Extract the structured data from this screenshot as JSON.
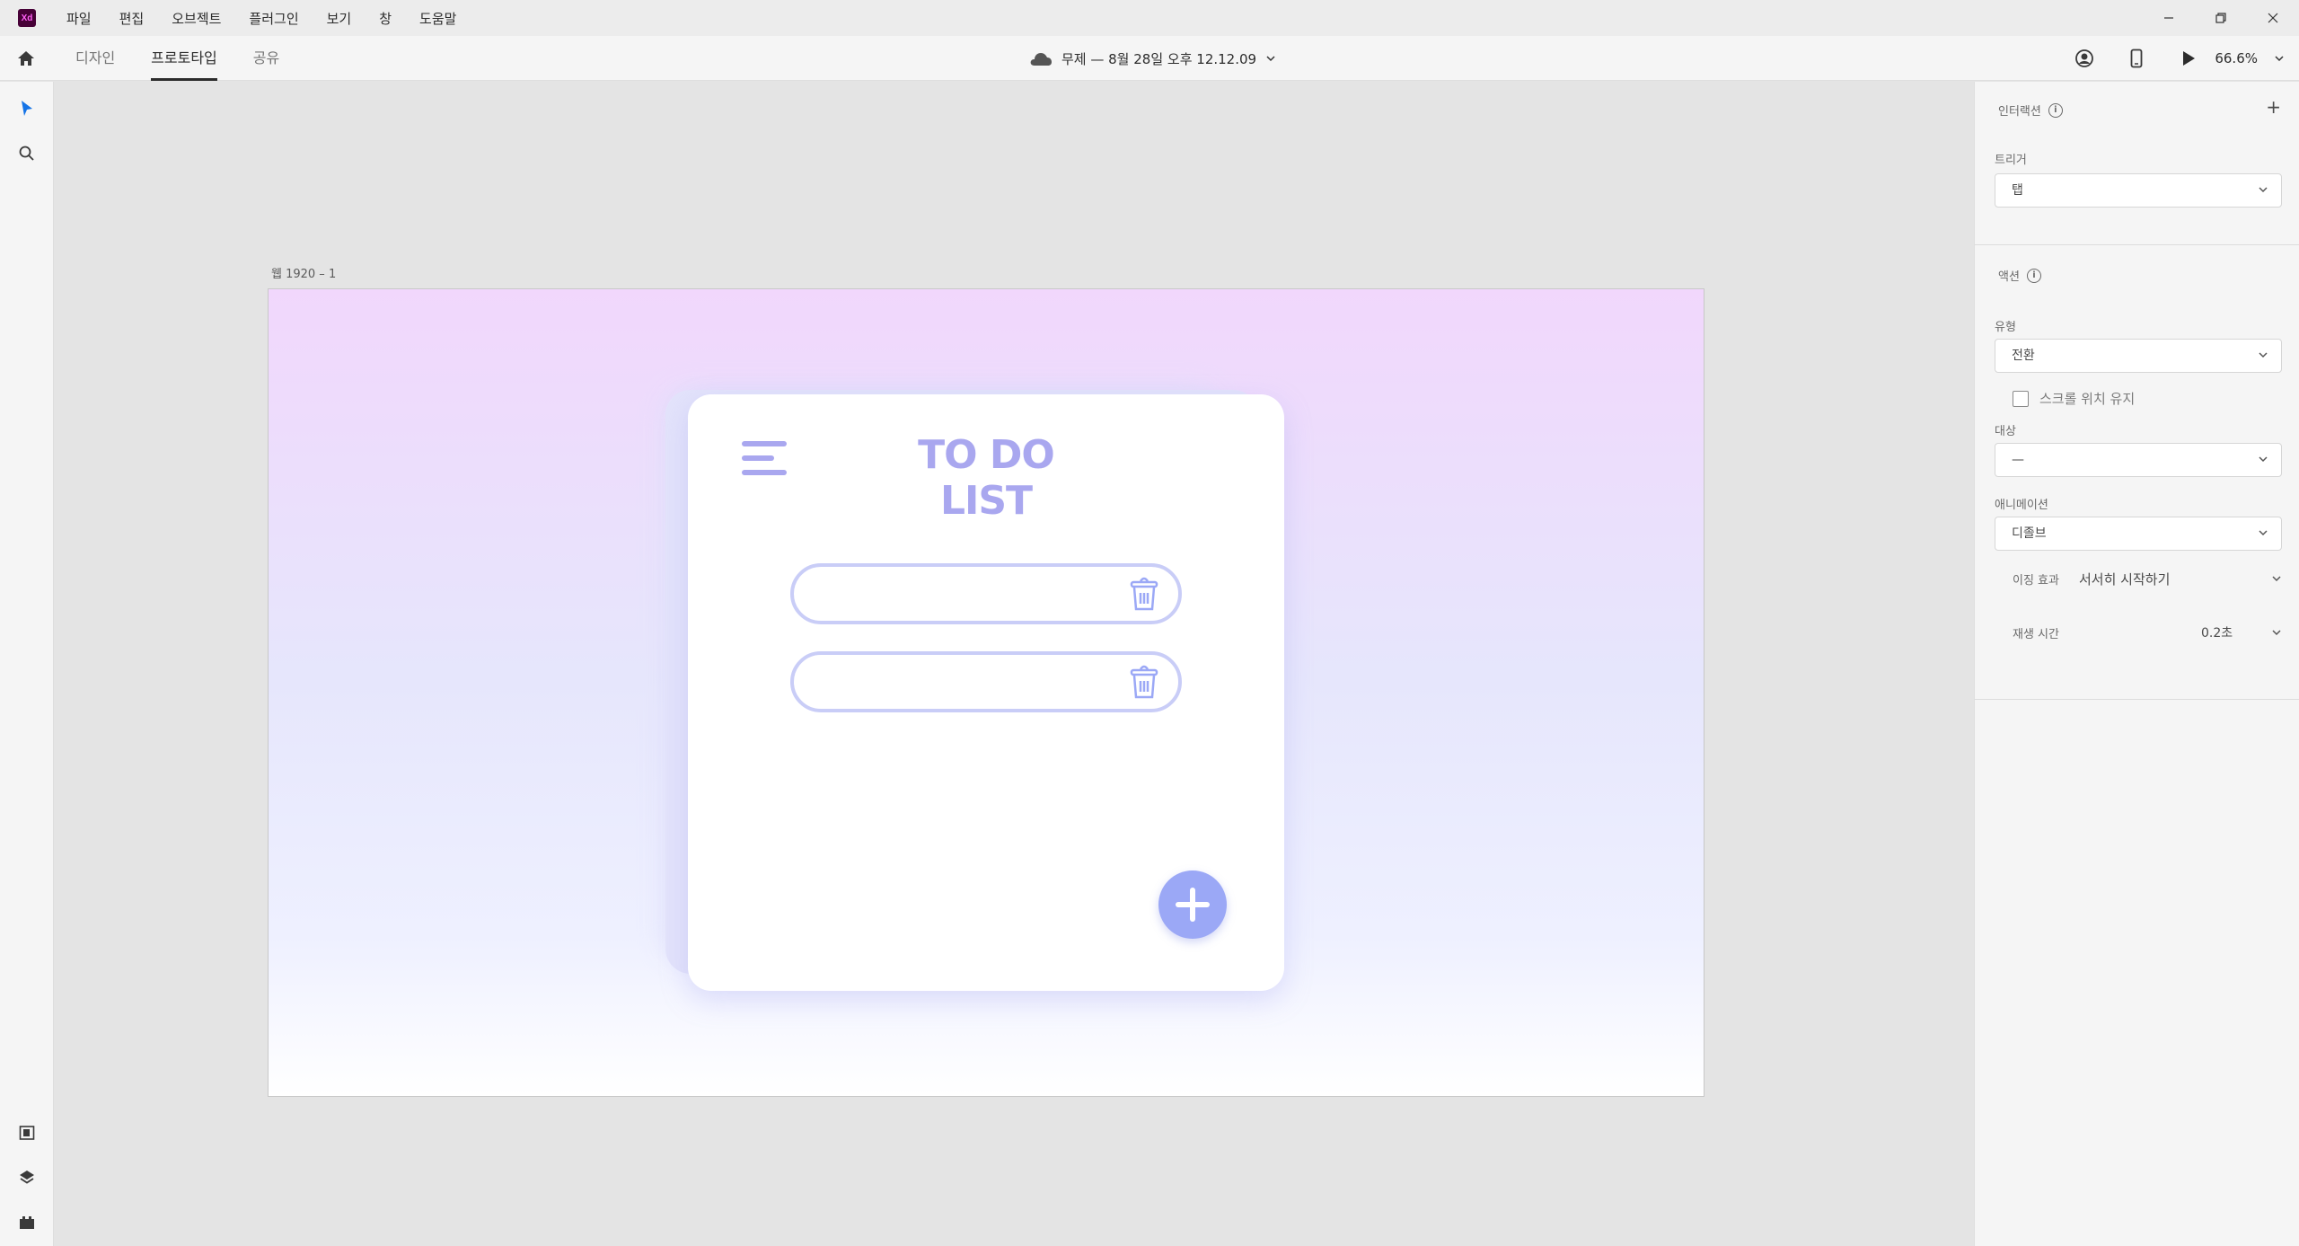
{
  "app": {
    "logo": "Xd"
  },
  "menu": [
    "파일",
    "편집",
    "오브젝트",
    "플러그인",
    "보기",
    "창",
    "도움말"
  ],
  "toolbar": {
    "tabs": [
      {
        "label": "디자인",
        "active": false
      },
      {
        "label": "프로토타입",
        "active": true
      },
      {
        "label": "공유",
        "active": false
      }
    ],
    "doc_title": "무제 — 8월 28일 오후 12.12.09",
    "zoom": "66.6%"
  },
  "canvas": {
    "artboard_label": "웹 1920 – 1",
    "card_title": "TO DO LIST"
  },
  "panel": {
    "interaction_title": "인터랙션",
    "trigger_label": "트리거",
    "trigger_value": "탭",
    "action_title": "액션",
    "type_label": "유형",
    "type_value": "전환",
    "keep_scroll_label": "스크롤 위치 유지",
    "target_label": "대상",
    "target_value": "—",
    "animation_label": "애니메이션",
    "animation_value": "디졸브",
    "easing_label": "이징 효과",
    "easing_value": "서서히 시작하기",
    "duration_label": "재생 시간",
    "duration_value": "0.2초"
  },
  "colors": {
    "accent": "#a9a7ef",
    "fab": "#9ba8f6",
    "row_border": "#c9cdf7"
  }
}
